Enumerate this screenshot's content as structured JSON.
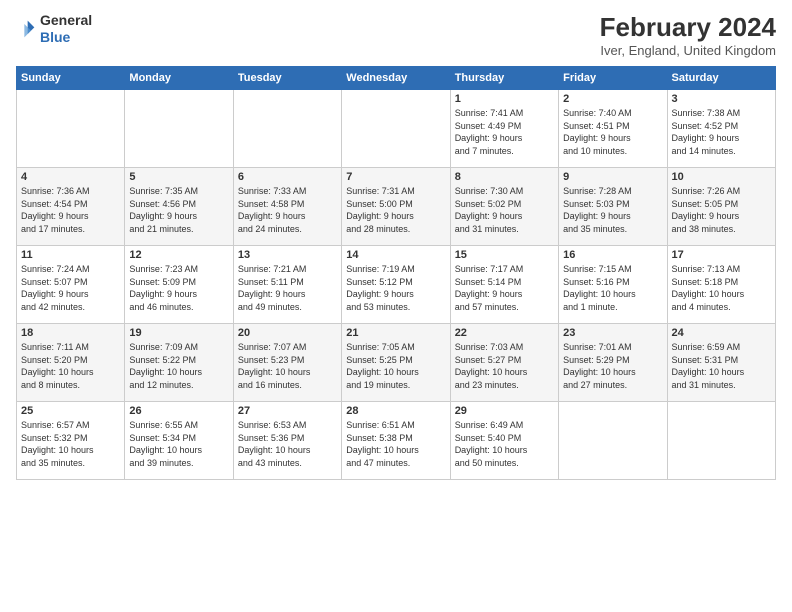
{
  "header": {
    "logo_line1": "General",
    "logo_line2": "Blue",
    "month_title": "February 2024",
    "location": "Iver, England, United Kingdom"
  },
  "weekdays": [
    "Sunday",
    "Monday",
    "Tuesday",
    "Wednesday",
    "Thursday",
    "Friday",
    "Saturday"
  ],
  "weeks": [
    [
      {
        "day": "",
        "info": ""
      },
      {
        "day": "",
        "info": ""
      },
      {
        "day": "",
        "info": ""
      },
      {
        "day": "",
        "info": ""
      },
      {
        "day": "1",
        "info": "Sunrise: 7:41 AM\nSunset: 4:49 PM\nDaylight: 9 hours\nand 7 minutes."
      },
      {
        "day": "2",
        "info": "Sunrise: 7:40 AM\nSunset: 4:51 PM\nDaylight: 9 hours\nand 10 minutes."
      },
      {
        "day": "3",
        "info": "Sunrise: 7:38 AM\nSunset: 4:52 PM\nDaylight: 9 hours\nand 14 minutes."
      }
    ],
    [
      {
        "day": "4",
        "info": "Sunrise: 7:36 AM\nSunset: 4:54 PM\nDaylight: 9 hours\nand 17 minutes."
      },
      {
        "day": "5",
        "info": "Sunrise: 7:35 AM\nSunset: 4:56 PM\nDaylight: 9 hours\nand 21 minutes."
      },
      {
        "day": "6",
        "info": "Sunrise: 7:33 AM\nSunset: 4:58 PM\nDaylight: 9 hours\nand 24 minutes."
      },
      {
        "day": "7",
        "info": "Sunrise: 7:31 AM\nSunset: 5:00 PM\nDaylight: 9 hours\nand 28 minutes."
      },
      {
        "day": "8",
        "info": "Sunrise: 7:30 AM\nSunset: 5:02 PM\nDaylight: 9 hours\nand 31 minutes."
      },
      {
        "day": "9",
        "info": "Sunrise: 7:28 AM\nSunset: 5:03 PM\nDaylight: 9 hours\nand 35 minutes."
      },
      {
        "day": "10",
        "info": "Sunrise: 7:26 AM\nSunset: 5:05 PM\nDaylight: 9 hours\nand 38 minutes."
      }
    ],
    [
      {
        "day": "11",
        "info": "Sunrise: 7:24 AM\nSunset: 5:07 PM\nDaylight: 9 hours\nand 42 minutes."
      },
      {
        "day": "12",
        "info": "Sunrise: 7:23 AM\nSunset: 5:09 PM\nDaylight: 9 hours\nand 46 minutes."
      },
      {
        "day": "13",
        "info": "Sunrise: 7:21 AM\nSunset: 5:11 PM\nDaylight: 9 hours\nand 49 minutes."
      },
      {
        "day": "14",
        "info": "Sunrise: 7:19 AM\nSunset: 5:12 PM\nDaylight: 9 hours\nand 53 minutes."
      },
      {
        "day": "15",
        "info": "Sunrise: 7:17 AM\nSunset: 5:14 PM\nDaylight: 9 hours\nand 57 minutes."
      },
      {
        "day": "16",
        "info": "Sunrise: 7:15 AM\nSunset: 5:16 PM\nDaylight: 10 hours\nand 1 minute."
      },
      {
        "day": "17",
        "info": "Sunrise: 7:13 AM\nSunset: 5:18 PM\nDaylight: 10 hours\nand 4 minutes."
      }
    ],
    [
      {
        "day": "18",
        "info": "Sunrise: 7:11 AM\nSunset: 5:20 PM\nDaylight: 10 hours\nand 8 minutes."
      },
      {
        "day": "19",
        "info": "Sunrise: 7:09 AM\nSunset: 5:22 PM\nDaylight: 10 hours\nand 12 minutes."
      },
      {
        "day": "20",
        "info": "Sunrise: 7:07 AM\nSunset: 5:23 PM\nDaylight: 10 hours\nand 16 minutes."
      },
      {
        "day": "21",
        "info": "Sunrise: 7:05 AM\nSunset: 5:25 PM\nDaylight: 10 hours\nand 19 minutes."
      },
      {
        "day": "22",
        "info": "Sunrise: 7:03 AM\nSunset: 5:27 PM\nDaylight: 10 hours\nand 23 minutes."
      },
      {
        "day": "23",
        "info": "Sunrise: 7:01 AM\nSunset: 5:29 PM\nDaylight: 10 hours\nand 27 minutes."
      },
      {
        "day": "24",
        "info": "Sunrise: 6:59 AM\nSunset: 5:31 PM\nDaylight: 10 hours\nand 31 minutes."
      }
    ],
    [
      {
        "day": "25",
        "info": "Sunrise: 6:57 AM\nSunset: 5:32 PM\nDaylight: 10 hours\nand 35 minutes."
      },
      {
        "day": "26",
        "info": "Sunrise: 6:55 AM\nSunset: 5:34 PM\nDaylight: 10 hours\nand 39 minutes."
      },
      {
        "day": "27",
        "info": "Sunrise: 6:53 AM\nSunset: 5:36 PM\nDaylight: 10 hours\nand 43 minutes."
      },
      {
        "day": "28",
        "info": "Sunrise: 6:51 AM\nSunset: 5:38 PM\nDaylight: 10 hours\nand 47 minutes."
      },
      {
        "day": "29",
        "info": "Sunrise: 6:49 AM\nSunset: 5:40 PM\nDaylight: 10 hours\nand 50 minutes."
      },
      {
        "day": "",
        "info": ""
      },
      {
        "day": "",
        "info": ""
      }
    ]
  ]
}
